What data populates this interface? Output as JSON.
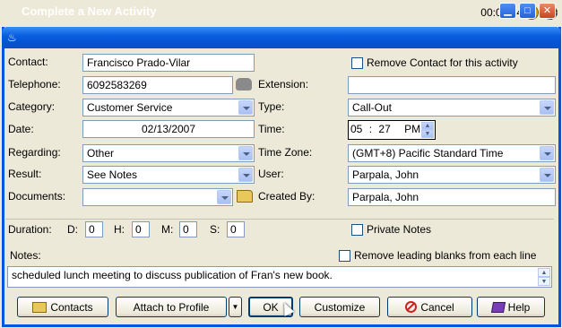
{
  "top": {
    "timer": "00:02:34"
  },
  "window": {
    "title": "Complete a New Activity"
  },
  "labels": {
    "contact": "Contact:",
    "telephone": "Telephone:",
    "category": "Category:",
    "date": "Date:",
    "regarding": "Regarding:",
    "result": "Result:",
    "documents": "Documents:",
    "extension": "Extension:",
    "type": "Type:",
    "time": "Time:",
    "timezone": "Time Zone:",
    "user": "User:",
    "created_by": "Created By:",
    "duration": "Duration:",
    "d": "D:",
    "h": "H:",
    "m": "M:",
    "s": "S:",
    "notes": "Notes:"
  },
  "values": {
    "contact": "Francisco Prado-Vilar",
    "telephone": "6092583269",
    "extension": "",
    "category": "Customer Service",
    "type": "Call-Out",
    "date": "02/13/2007",
    "time_h": "05",
    "time_colon": ":",
    "time_m": "27",
    "time_ampm": "PM",
    "regarding": "Other",
    "timezone": "(GMT+8) Pacific Standard Time",
    "result": "See Notes",
    "user": "Parpala, John",
    "documents": "",
    "created_by": "Parpala, John",
    "dur_d": "0",
    "dur_h": "0",
    "dur_m": "0",
    "dur_s": "0",
    "notes": "scheduled lunch meeting to discuss publication of Fran's new book."
  },
  "checkboxes": {
    "remove_contact": "Remove Contact for this activity",
    "private_notes": "Private Notes",
    "remove_blanks": "Remove leading blanks from each line"
  },
  "buttons": {
    "contacts": "Contacts",
    "attach": "Attach to Profile",
    "ok": "OK",
    "customize": "Customize",
    "cancel": "Cancel",
    "help": "Help"
  }
}
